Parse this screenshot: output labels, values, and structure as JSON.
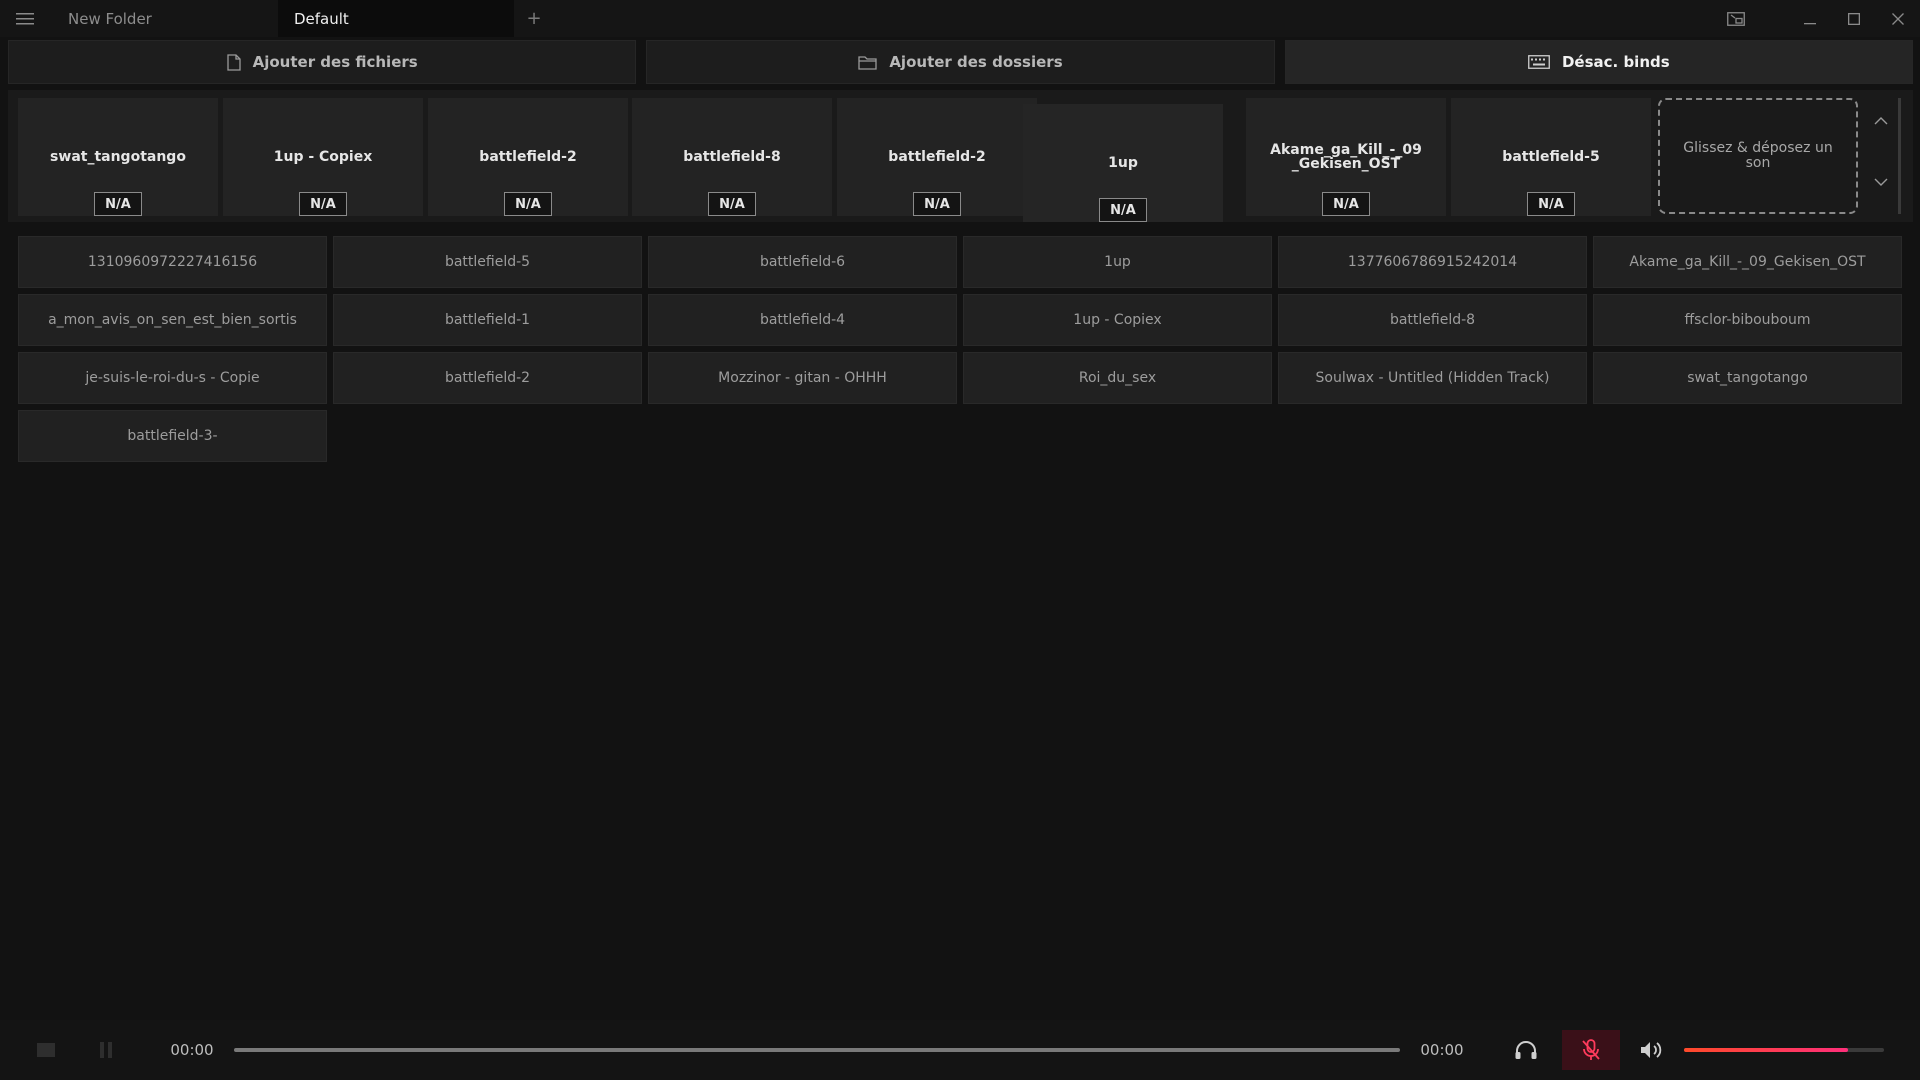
{
  "titlebar": {
    "tabs": [
      {
        "label": "New Folder",
        "active": false
      },
      {
        "label": "Default",
        "active": true
      }
    ],
    "add_tab_label": "+"
  },
  "actions": {
    "add_files": "Ajouter des fichiers",
    "add_folders": "Ajouter des dossiers",
    "disable_binds": "Désac. binds"
  },
  "binds": [
    {
      "name": "swat_tangotango",
      "key": "N/A"
    },
    {
      "name": "1up - Copiex",
      "key": "N/A"
    },
    {
      "name": "battlefield-2",
      "key": "N/A"
    },
    {
      "name": "battlefield-8",
      "key": "N/A"
    },
    {
      "name": "battlefield-2",
      "key": "N/A"
    },
    {
      "name": "1up",
      "key": "N/A"
    },
    {
      "name": "Akame_ga_Kill_-_09 _Gekisen_OST",
      "key": "N/A"
    },
    {
      "name": "battlefield-5",
      "key": "N/A"
    }
  ],
  "dropzone": {
    "label": "Glissez & déposez un son"
  },
  "sounds": [
    "1310960972227416156",
    "battlefield-5",
    "battlefield-6",
    "1up",
    "1377606786915242014",
    "Akame_ga_Kill_-_09_Gekisen_OST",
    "a_mon_avis_on_sen_est_bien_sortis",
    "battlefield-1",
    "battlefield-4",
    "1up - Copiex",
    "battlefield-8",
    "ffsclor-bibouboum",
    "je-suis-le-roi-du-s - Copie",
    "battlefield-2",
    "Mozzinor - gitan - OHHH",
    "Roi_du_sex",
    "Soulwax - Untitled (Hidden Track)",
    "swat_tangotango",
    "battlefield-3-"
  ],
  "player": {
    "time_current": "00:00",
    "time_total": "00:00",
    "progress": 0,
    "volume": 0.82
  },
  "colors": {
    "accent_start": "#ff4a2a",
    "accent_end": "#ff2f7a",
    "mic_muted": "#ff3b5c"
  },
  "icons": {
    "menu": "hamburger-icon",
    "mini_player": "picture-in-picture-icon",
    "minimize": "minimize-icon",
    "maximize": "maximize-icon",
    "close": "close-icon",
    "file": "file-icon",
    "folder": "folder-icon",
    "keyboard": "keyboard-icon",
    "stop": "stop-icon",
    "pause": "pause-icon",
    "headphones": "headphones-icon",
    "mic_off": "mic-off-icon",
    "volume": "volume-icon"
  }
}
